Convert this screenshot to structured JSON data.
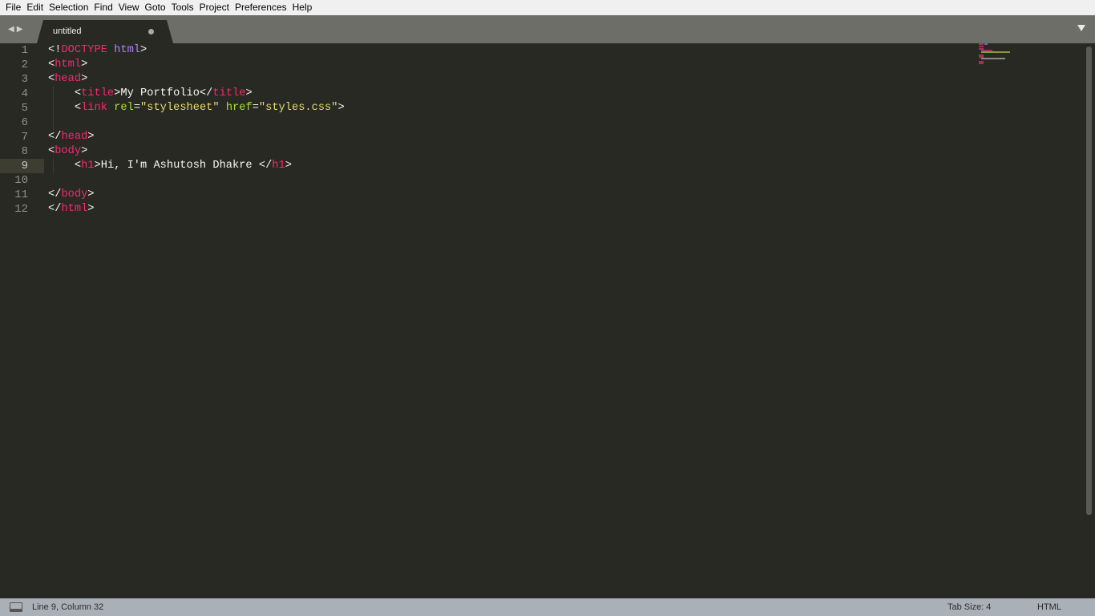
{
  "menu": [
    "File",
    "Edit",
    "Selection",
    "Find",
    "View",
    "Goto",
    "Tools",
    "Project",
    "Preferences",
    "Help"
  ],
  "tab": {
    "title": "untitled"
  },
  "editor": {
    "current_line": 9,
    "lines": [
      [
        [
          "<!",
          "p"
        ],
        [
          "DOCTYPE",
          "doc"
        ],
        [
          " ",
          "p"
        ],
        [
          "html",
          "kw"
        ],
        [
          ">",
          "p"
        ]
      ],
      [
        [
          "<",
          "p"
        ],
        [
          "html",
          "tag"
        ],
        [
          ">",
          "p"
        ]
      ],
      [
        [
          "<",
          "p"
        ],
        [
          "head",
          "tag"
        ],
        [
          ">",
          "p"
        ]
      ],
      [
        [
          "    <",
          "p"
        ],
        [
          "title",
          "tag"
        ],
        [
          ">My Portfolio</",
          "p"
        ],
        [
          "title",
          "tag"
        ],
        [
          ">",
          "p"
        ]
      ],
      [
        [
          "    <",
          "p"
        ],
        [
          "link",
          "tag"
        ],
        [
          " ",
          "p"
        ],
        [
          "rel",
          "attr"
        ],
        [
          "=",
          "p"
        ],
        [
          "\"stylesheet\"",
          "str"
        ],
        [
          " ",
          "p"
        ],
        [
          "href",
          "attr"
        ],
        [
          "=",
          "p"
        ],
        [
          "\"styles.css\"",
          "str"
        ],
        [
          ">",
          "p"
        ]
      ],
      [],
      [
        [
          "</",
          "p"
        ],
        [
          "head",
          "tag"
        ],
        [
          ">",
          "p"
        ]
      ],
      [
        [
          "<",
          "p"
        ],
        [
          "body",
          "tag"
        ],
        [
          ">",
          "p"
        ]
      ],
      [
        [
          "    <",
          "p"
        ],
        [
          "h1",
          "tag"
        ],
        [
          ">Hi, I'm Ashutosh Dhakre </",
          "p"
        ],
        [
          "h1",
          "tag"
        ],
        [
          ">",
          "p"
        ]
      ],
      [],
      [
        [
          "</",
          "p"
        ],
        [
          "body",
          "tag"
        ],
        [
          ">",
          "p"
        ]
      ],
      [
        [
          "</",
          "p"
        ],
        [
          "html",
          "tag"
        ],
        [
          ">",
          "p"
        ]
      ]
    ]
  },
  "status": {
    "position": "Line 9, Column 32",
    "tab_size": "Tab Size: 4",
    "syntax": "HTML"
  }
}
